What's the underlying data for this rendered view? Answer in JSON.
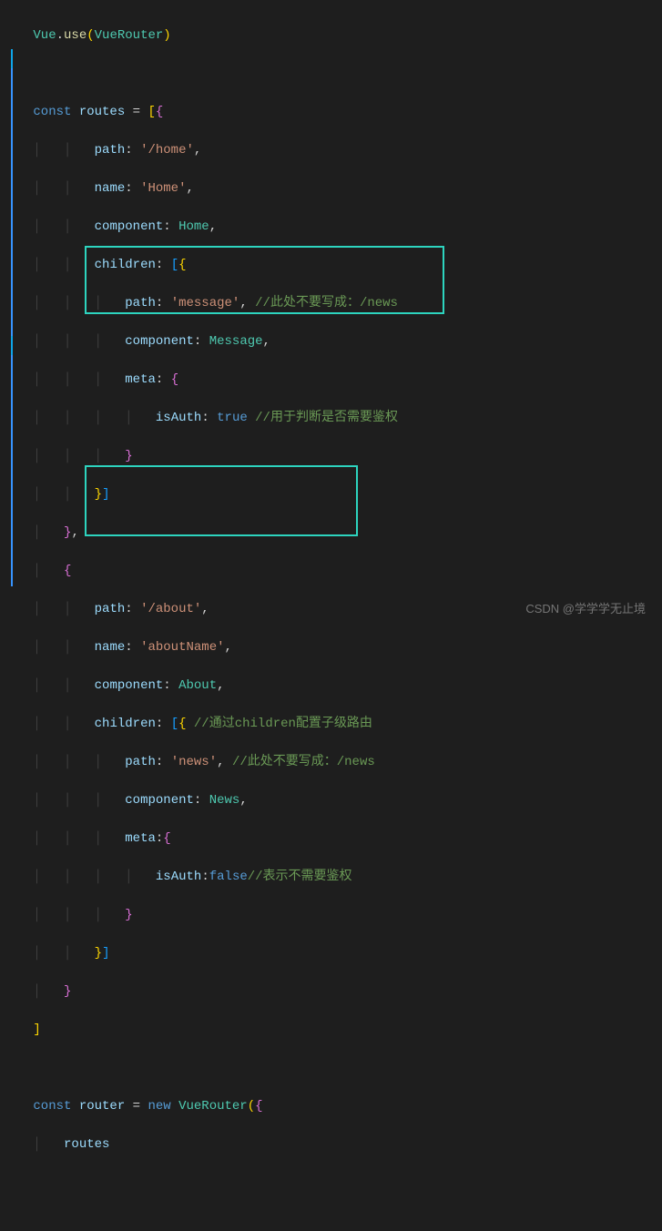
{
  "lines": {
    "l1": "Vue",
    "l1b": ".",
    "l1c": "use",
    "l1d": "(",
    "l1e": "VueRouter",
    "l1f": ")",
    "const": "const",
    "routes": "routes",
    "eq": " = ",
    "path": "path",
    "name": "name",
    "component": "component",
    "children": "children",
    "meta": "meta",
    "isAuth": "isAuth",
    "home_path": "'/home'",
    "home_name": "'Home'",
    "home_comp": "Home",
    "msg_path": "'message'",
    "msg_comp": "Message",
    "msg_comment": "//此处不要写成：/news",
    "meta_comment1": "//用于判断是否需要鉴权",
    "true": "true",
    "about_path": "'/about'",
    "about_name": "'aboutName'",
    "about_comp": "About",
    "children_comment": "//通过children配置子级路由",
    "news_path": "'news'",
    "news_comment": "//此处不要写成：/news",
    "news_comp": "News",
    "false": "false",
    "meta_comment2": "//表示不需要鉴权",
    "router": "router",
    "new": "new",
    "VueRouter": "VueRouter",
    "routes2": "routes"
  },
  "watermark": "CSDN @学学学无止境"
}
